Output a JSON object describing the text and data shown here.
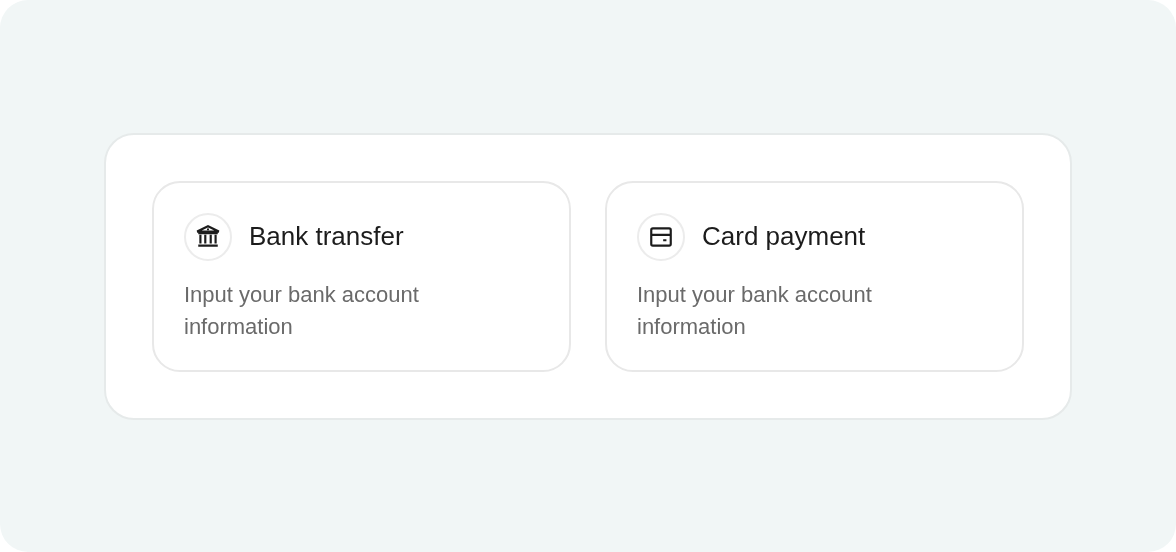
{
  "payment_options": [
    {
      "kind": "bank",
      "title": "Bank transfer",
      "description": "Input your bank account information"
    },
    {
      "kind": "card",
      "title": "Card payment",
      "description": "Input your bank account information"
    }
  ]
}
